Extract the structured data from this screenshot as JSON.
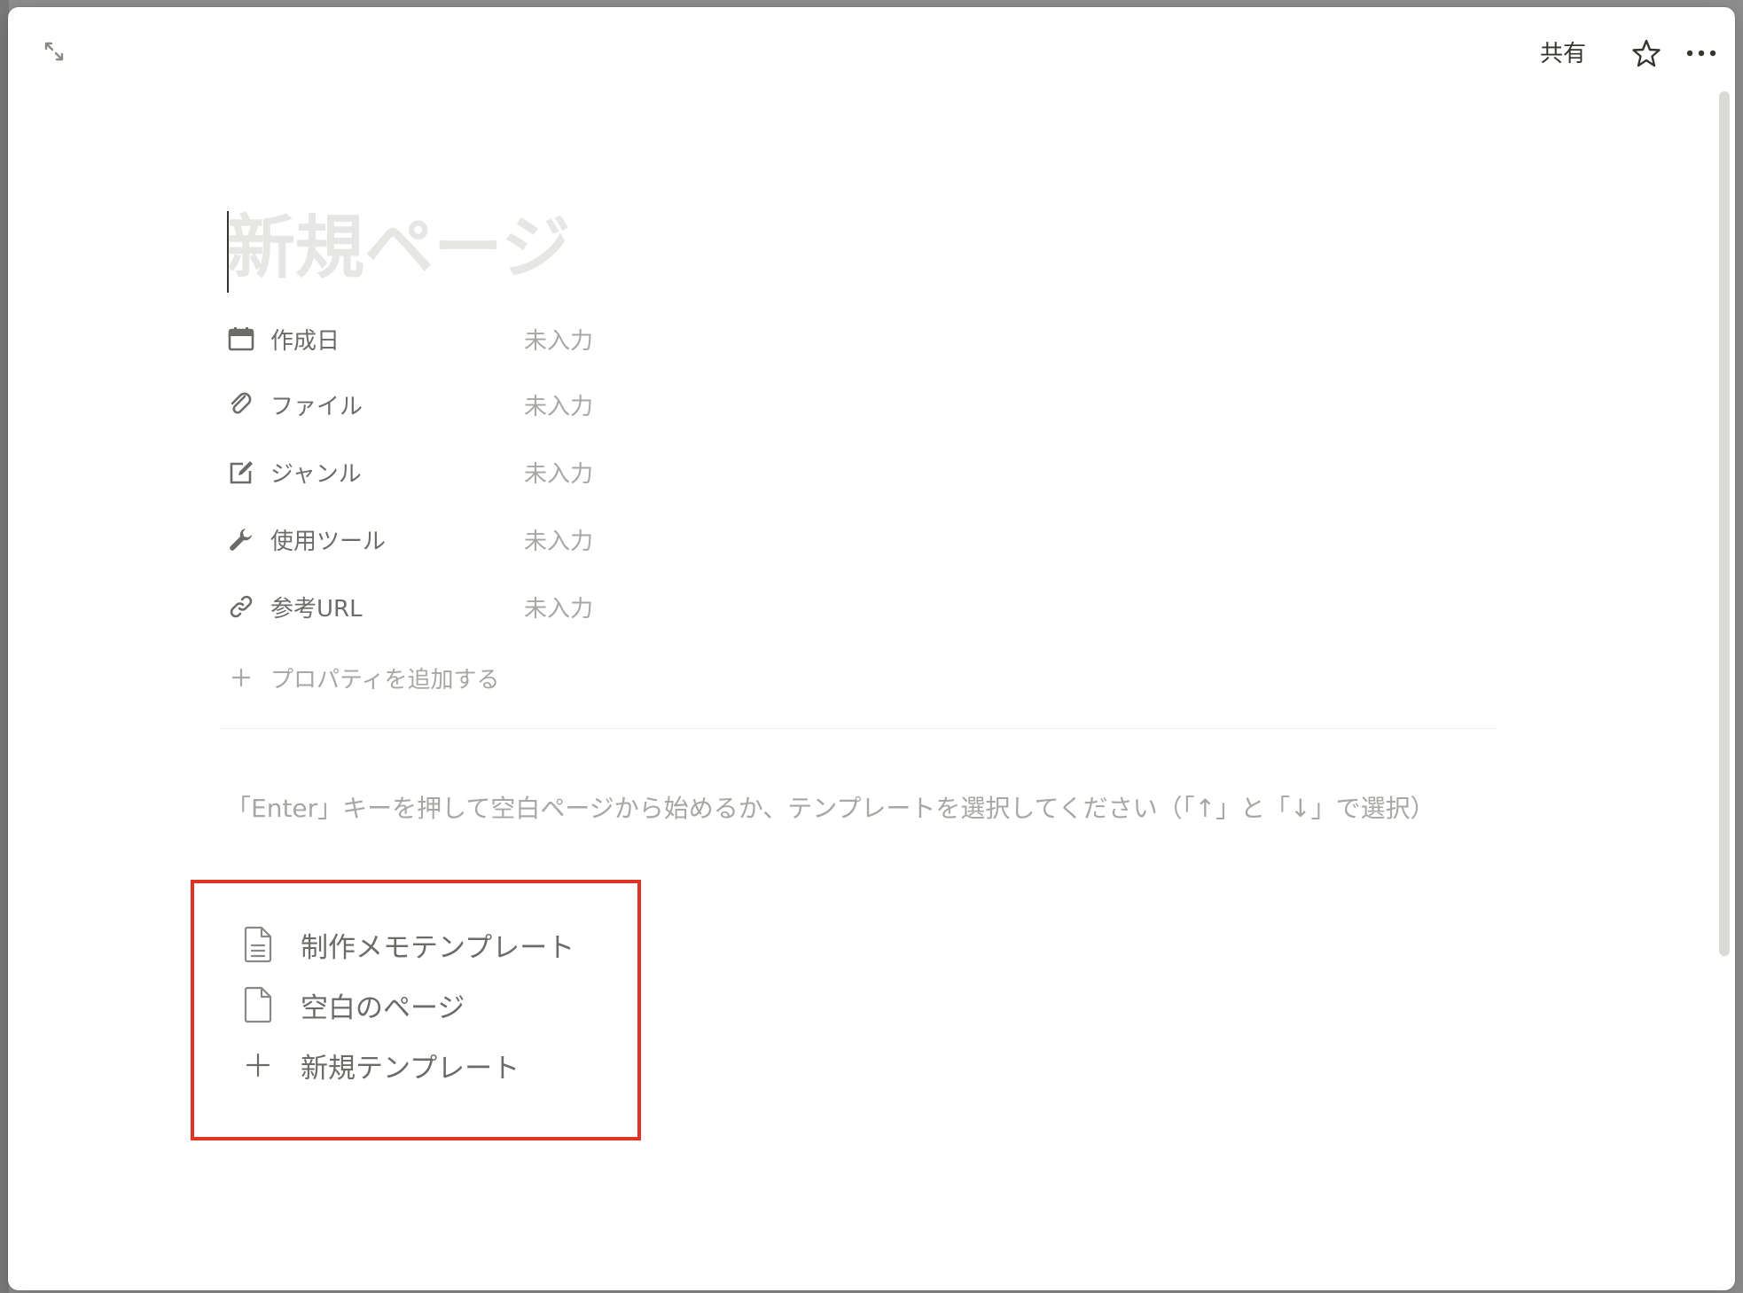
{
  "topbar": {
    "share_label": "共有",
    "icons": {
      "expand": "expand-arrows-icon",
      "favorite": "star-outline-icon",
      "more": "more-horizontal-icon"
    }
  },
  "page": {
    "title_placeholder": "新規ページ"
  },
  "properties": [
    {
      "icon": "calendar-icon",
      "label": "作成日",
      "value": "未入力"
    },
    {
      "icon": "paperclip-icon",
      "label": "ファイル",
      "value": "未入力"
    },
    {
      "icon": "edit-checkbox-icon",
      "label": "ジャンル",
      "value": "未入力"
    },
    {
      "icon": "wrench-icon",
      "label": "使用ツール",
      "value": "未入力"
    },
    {
      "icon": "link-icon",
      "label": "参考URL",
      "value": "未入力"
    }
  ],
  "add_property_label": "プロパティを追加する",
  "hint_text": "「Enter」キーを押して空白ページから始めるか、テンプレートを選択してください（「↑」と「↓」で選択）",
  "templates": [
    {
      "icon": "document-lines-icon",
      "label": "制作メモテンプレート"
    },
    {
      "icon": "document-blank-icon",
      "label": "空白のページ"
    },
    {
      "icon": "plus-icon",
      "label": "新規テンプレート"
    }
  ],
  "colors": {
    "highlight_border": "#e03524",
    "text_primary": "#37352f",
    "text_secondary": "#6b6b68",
    "text_muted": "#a8a7a4",
    "title_placeholder": "#e6e6e4"
  }
}
